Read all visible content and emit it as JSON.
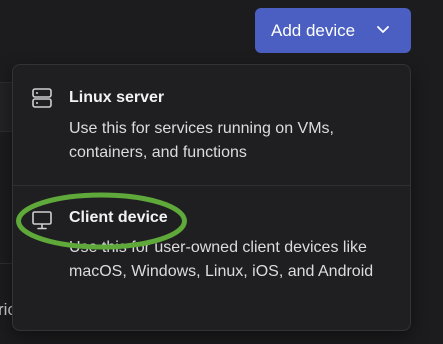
{
  "header": {
    "add_device_label": "Add device",
    "add_device_icon": "chevron-down-icon"
  },
  "background": {
    "partial_text": "ric"
  },
  "menu": {
    "items": [
      {
        "icon": "server-icon",
        "title": "Linux server",
        "description": "Use this for services running on VMs, containers, and functions"
      },
      {
        "icon": "monitor-icon",
        "title": "Client device",
        "description": "Use this for user-owned client devices like macOS, Windows, Linux, iOS, and Android"
      }
    ]
  },
  "annotation": {
    "highlight_color": "#5fa83a"
  },
  "colors": {
    "background": "#1c1c1e",
    "menu_background": "#1f1f21",
    "accent_button": "#4a5fc1",
    "text_primary": "#f2f2f4"
  }
}
